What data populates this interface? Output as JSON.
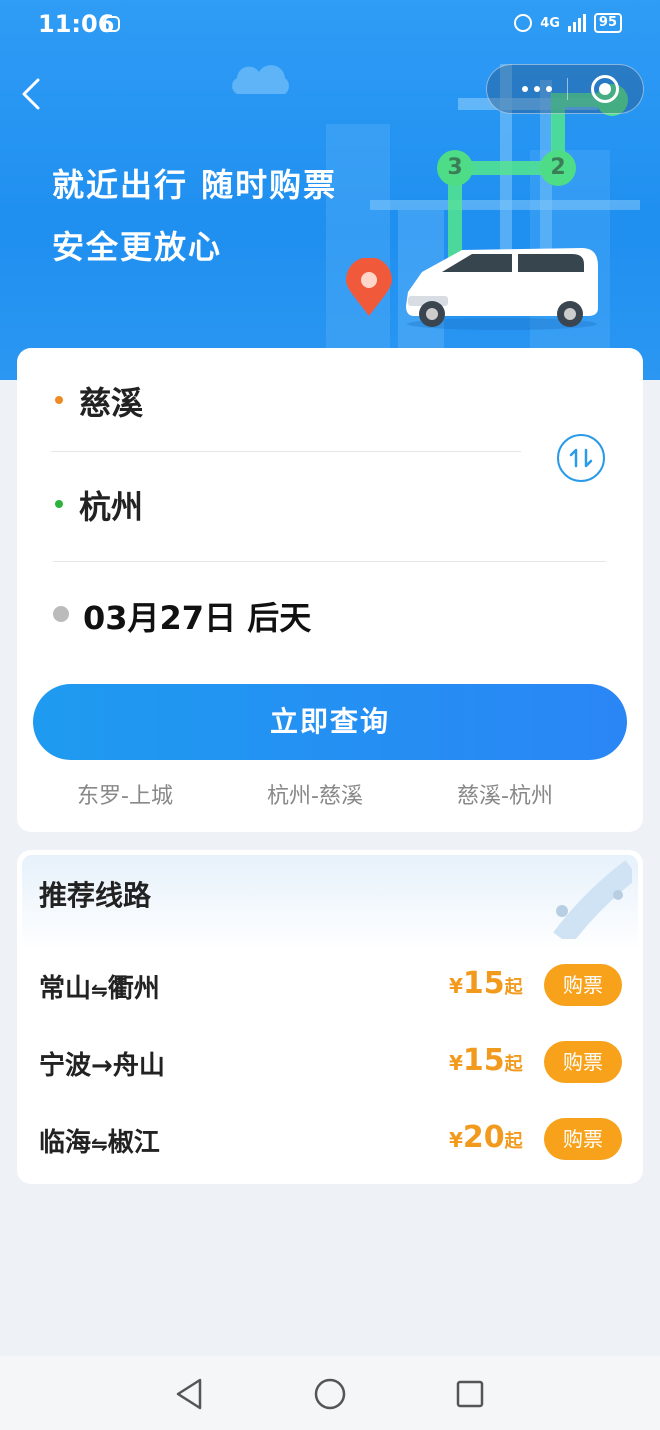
{
  "status_bar": {
    "time": "11:06",
    "network": "4G",
    "battery": "95"
  },
  "hero": {
    "slogan_line1": "就近出行 随时购票",
    "slogan_line2": "安全更放心",
    "map_markers": [
      "3",
      "2"
    ]
  },
  "search": {
    "from": "慈溪",
    "to": "杭州",
    "date": "03月27日 后天",
    "submit_label": "立即查询",
    "history": [
      "东罗-上城",
      "杭州-慈溪",
      "慈溪-杭州"
    ]
  },
  "recommend": {
    "title": "推荐线路",
    "routes": [
      {
        "from": "常山",
        "arrow": "⇋",
        "to": "衢州",
        "currency": "¥",
        "price": "15",
        "suffix": "起",
        "button": "购票"
      },
      {
        "from": "宁波",
        "arrow": "→",
        "to": "舟山",
        "currency": "¥",
        "price": "15",
        "suffix": "起",
        "button": "购票"
      },
      {
        "from": "临海",
        "arrow": "⇋",
        "to": "椒江",
        "currency": "¥",
        "price": "20",
        "suffix": "起",
        "button": "购票"
      }
    ]
  },
  "colors": {
    "primary": "#1f8ff0",
    "price": "#f29a1d",
    "buy_button": "#f7a21a",
    "from_dot": "#f08a24",
    "to_dot": "#2db33c"
  }
}
